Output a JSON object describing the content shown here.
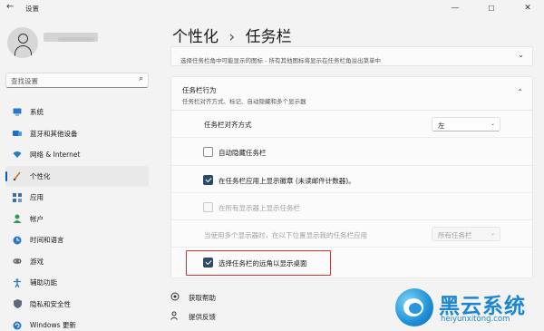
{
  "window": {
    "title": "设置",
    "back_icon": "←",
    "minimize_icon": "—",
    "maximize_icon": "☐",
    "close_icon": "✕"
  },
  "search": {
    "placeholder": "查找设置",
    "icon": "⌕"
  },
  "sidebar": {
    "items": [
      {
        "label": "系统",
        "icon": "monitor-icon",
        "color": "#2a78c8",
        "active": false
      },
      {
        "label": "蓝牙和其他设备",
        "icon": "bluetooth-icon",
        "color": "#1f6fbf",
        "active": false
      },
      {
        "label": "网络 & Internet",
        "icon": "wifi-icon",
        "color": "#2a78c8",
        "active": false
      },
      {
        "label": "个性化",
        "icon": "brush-icon",
        "color": "#c07a30",
        "active": true
      },
      {
        "label": "应用",
        "icon": "apps-icon",
        "color": "#3a6fa8",
        "active": false
      },
      {
        "label": "帐户",
        "icon": "account-icon",
        "color": "#2d9a5a",
        "active": false
      },
      {
        "label": "时间和语言",
        "icon": "globe-clock-icon",
        "color": "#2a78c8",
        "active": false
      },
      {
        "label": "游戏",
        "icon": "gamepad-icon",
        "color": "#6b6b6b",
        "active": false
      },
      {
        "label": "辅助功能",
        "icon": "accessibility-icon",
        "color": "#2a78c8",
        "active": false
      },
      {
        "label": "隐私和安全性",
        "icon": "shield-icon",
        "color": "#5b6b7b",
        "active": false
      },
      {
        "label": "Windows 更新",
        "icon": "update-icon",
        "color": "#2a78c8",
        "active": false
      }
    ]
  },
  "breadcrumb": {
    "parent": "个性化",
    "separator": "›",
    "current": "任务栏"
  },
  "top_card": {
    "description": "选择任务栏角中可能显示的图标 - 所有其他图标将显示在任务栏角溢出菜单中",
    "chevron": "⌄"
  },
  "behaviors": {
    "title": "任务栏行为",
    "subtitle": "任务栏对齐方式、标记、自动隐藏和多个显示器",
    "chevron": "⌃",
    "alignment": {
      "label": "任务栏对齐方式",
      "value": "左",
      "arrow": "⌄"
    },
    "auto_hide": {
      "label": "自动隐藏任务栏",
      "checked": false
    },
    "badges": {
      "label": "在任务栏应用上显示徽章 (未读邮件计数器)。",
      "checked": true
    },
    "all_displays": {
      "label": "在所有显示器上显示任务栏",
      "checked": false,
      "disabled": true
    },
    "multi_display": {
      "label": "当使用多个显示器时，在以下位置显示我的任务栏应用",
      "value": "所有任务栏",
      "arrow": "⌄",
      "disabled": true
    },
    "far_corner": {
      "label": "选择任务栏的远角以显示桌面",
      "checked": true
    }
  },
  "links": {
    "help": {
      "label": "获取帮助",
      "icon": "help-icon"
    },
    "feedback": {
      "label": "提供反馈",
      "icon": "feedback-icon"
    }
  },
  "watermark": {
    "brand": "黑云系统",
    "url": "heiyunxitong.com"
  },
  "colors": {
    "accent": "#005fb8",
    "checkbox": "#2d4a66",
    "highlight": "#d8322c",
    "watermark": "#1b86d3"
  }
}
